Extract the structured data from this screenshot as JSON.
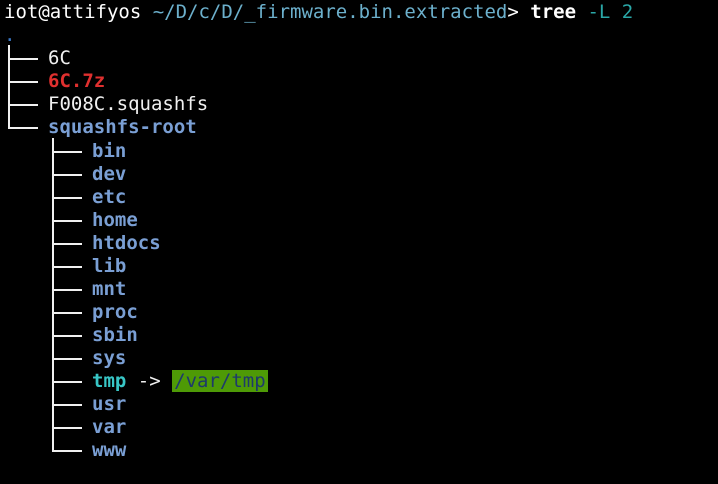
{
  "prompt": {
    "user_host": "iot@attifyos",
    "cwd": "~/D/c/D/_firmware.bin.extracted",
    "symbol": ">",
    "command": "tree",
    "args": "-L 2"
  },
  "tree": {
    "root": ".",
    "entries": [
      {
        "name": "6C",
        "type": "file"
      },
      {
        "name": "6C.7z",
        "type": "archive"
      },
      {
        "name": "F008C.squashfs",
        "type": "file"
      },
      {
        "name": "squashfs-root",
        "type": "dir"
      }
    ],
    "children": [
      {
        "name": "bin",
        "type": "dir"
      },
      {
        "name": "dev",
        "type": "dir"
      },
      {
        "name": "etc",
        "type": "dir"
      },
      {
        "name": "home",
        "type": "dir"
      },
      {
        "name": "htdocs",
        "type": "dir"
      },
      {
        "name": "lib",
        "type": "dir"
      },
      {
        "name": "mnt",
        "type": "dir"
      },
      {
        "name": "proc",
        "type": "dir"
      },
      {
        "name": "sbin",
        "type": "dir"
      },
      {
        "name": "sys",
        "type": "dir"
      },
      {
        "name": "tmp",
        "type": "symlink",
        "arrow": "->",
        "target": "/var/tmp"
      },
      {
        "name": "usr",
        "type": "dir"
      },
      {
        "name": "var",
        "type": "dir"
      },
      {
        "name": "www",
        "type": "dir"
      }
    ]
  },
  "colors": {
    "background": "#000000",
    "path": "#6cb0cc",
    "archive": "#e0302f",
    "directory": "#7a9fd4",
    "symlink": "#38c6c6",
    "link_target_bg": "#4e9a06"
  }
}
